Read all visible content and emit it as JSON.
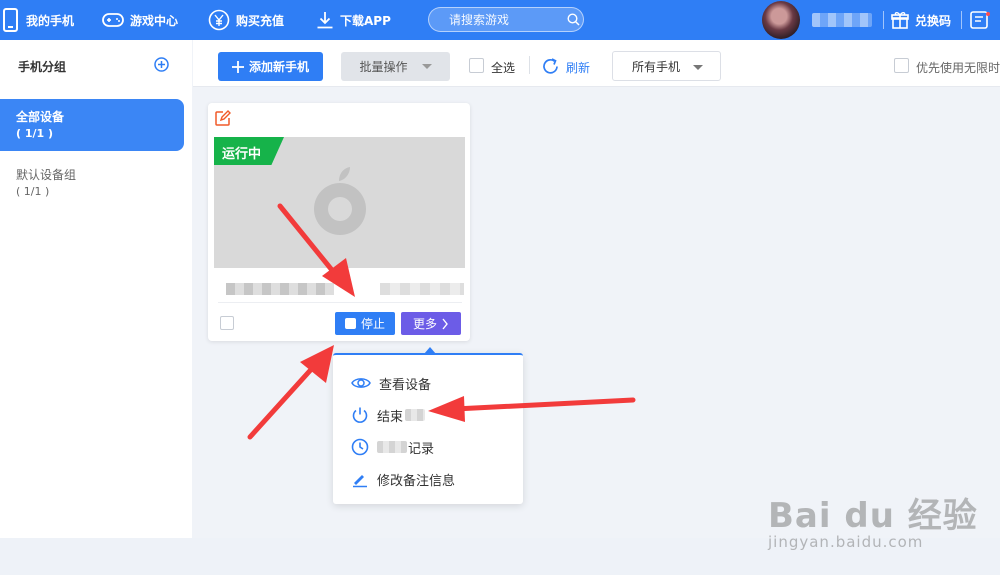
{
  "topbar": {
    "nav": [
      {
        "label": "我的手机",
        "icon": "phone-icon"
      },
      {
        "label": "游戏中心",
        "icon": "gamepad-icon"
      },
      {
        "label": "购买充值",
        "icon": "yuan-icon"
      },
      {
        "label": "下载APP",
        "icon": "download-icon"
      }
    ],
    "search_placeholder": "请搜索游戏",
    "redeem_label": "兑换码",
    "brand_color": "#2f7ef5"
  },
  "sidebar": {
    "title": "手机分组",
    "groups": [
      {
        "name": "全部设备",
        "count": "( 1/1 )",
        "active": true
      },
      {
        "name": "默认设备组",
        "count": "( 1/1 )",
        "active": false
      }
    ]
  },
  "toolbar": {
    "add_label": "添加新手机",
    "batch_label": "批量操作",
    "select_all_label": "全选",
    "refresh_label": "刷新",
    "filter_value": "所有手机",
    "prefer_label": "优先使用无限时"
  },
  "device_card": {
    "status": "运行中",
    "status_color": "#16b34a",
    "stop_label": "停止",
    "more_label": "更多"
  },
  "menu": {
    "items": [
      {
        "label": "查看设备",
        "icon": "eye-icon"
      },
      {
        "label": "结束",
        "icon": "power-icon"
      },
      {
        "label": "记录",
        "icon": "clock-icon"
      },
      {
        "label": "修改备注信息",
        "icon": "pencil-icon"
      }
    ]
  },
  "watermark": {
    "brand": "Bai du 经验",
    "sub": "jingyan.baidu.com"
  }
}
